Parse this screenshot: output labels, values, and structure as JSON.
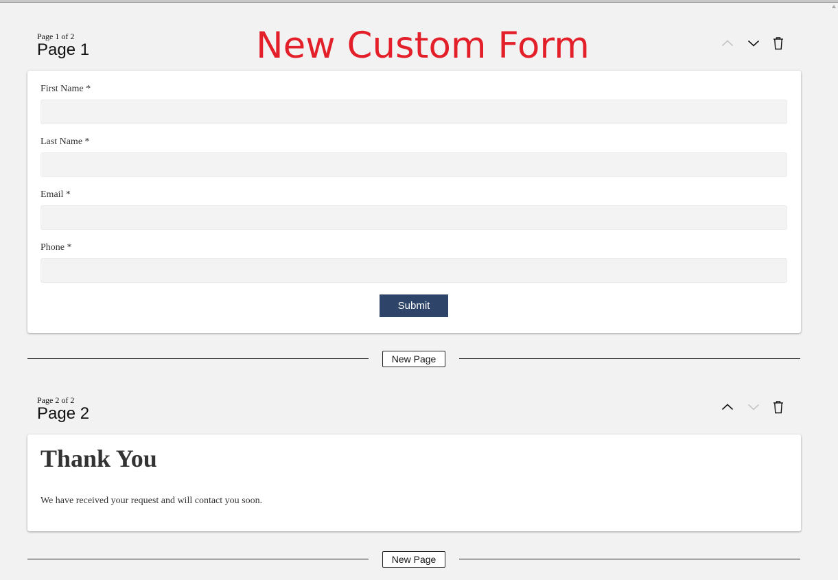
{
  "form": {
    "title": "New Custom Form"
  },
  "pages": [
    {
      "count_label": "Page 1 of 2",
      "name": "Page 1",
      "move_up_enabled": false,
      "move_down_enabled": true,
      "fields": [
        {
          "label": "First Name *",
          "value": "",
          "placeholder": ""
        },
        {
          "label": "Last Name *",
          "value": "",
          "placeholder": ""
        },
        {
          "label": "Email *",
          "value": "",
          "placeholder": ""
        },
        {
          "label": "Phone *",
          "value": "",
          "placeholder": ""
        }
      ],
      "submit_label": "Submit"
    },
    {
      "count_label": "Page 2 of 2",
      "name": "Page 2",
      "move_up_enabled": true,
      "move_down_enabled": false,
      "heading": "Thank You",
      "message": "We have received your request and will contact you soon."
    }
  ],
  "dividers": [
    {
      "new_page_label": "New Page"
    },
    {
      "new_page_label": "New Page"
    }
  ],
  "colors": {
    "title": "#e3202a",
    "submit_bg": "#2e4468",
    "background": "#f2f2f2",
    "icon_enabled": "#111111",
    "icon_disabled": "#c4c4c4"
  },
  "icons": {
    "move_up": "chevron-up-icon",
    "move_down": "chevron-down-icon",
    "delete": "trash-icon"
  }
}
